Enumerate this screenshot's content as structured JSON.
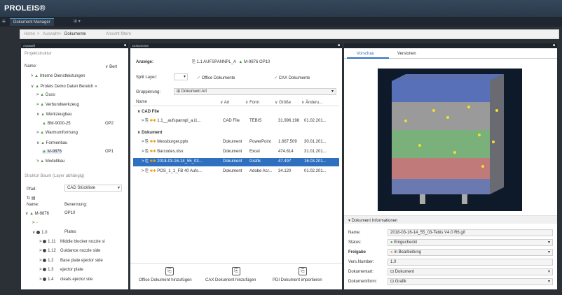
{
  "app": {
    "title": "PROLEIS®"
  },
  "tabs": [
    {
      "label": "Dokument Manager"
    },
    {
      "label": "⊞ ▾"
    }
  ],
  "breadcrumb": {
    "items": [
      "Home",
      "Auswahl",
      "Dokumente"
    ],
    "extra": "Ansicht filtern",
    "sep": ">"
  },
  "left": {
    "header": "Auswahl",
    "section": "Projektstruktur",
    "name_label": "Name:",
    "name_value": "Bert",
    "tree": [
      {
        "label": "Interne Dienstleistungen",
        "indent": 0,
        "arrow": ">"
      },
      {
        "label": "Proleis Demo Daten Bereich »",
        "indent": 0,
        "arrow": "∨"
      },
      {
        "label": "Guss",
        "indent": 1,
        "arrow": ">"
      },
      {
        "label": "Verbundwerkzeug",
        "indent": 1,
        "arrow": ">"
      },
      {
        "label": "Werkzeugbau",
        "indent": 1,
        "arrow": "∨"
      },
      {
        "label": "BM-9000-25",
        "indent": 2,
        "arrow": "",
        "suffix": "OP2"
      },
      {
        "label": "Warmumformung",
        "indent": 1,
        "arrow": ">"
      },
      {
        "label": "Formenbau",
        "indent": 1,
        "arrow": "∨"
      },
      {
        "label": "M-9876",
        "indent": 2,
        "arrow": "",
        "suffix": "OP1",
        "selected": true
      },
      {
        "label": "Modellbau",
        "indent": 1,
        "arrow": ">"
      }
    ],
    "struct_section": "Struktur Baum (Layer abhängig)",
    "pfad_label": "Pfad:",
    "pfad_value": "CAD Stückliste",
    "cols": [
      "Name:",
      "Benennung:"
    ],
    "struct": [
      {
        "name": "M-9876",
        "ben": "OP10",
        "indent": 0,
        "arrow": "∨"
      },
      {
        "name": "",
        "ben": "",
        "indent": 1,
        "arrow": ">"
      },
      {
        "name": "1.0",
        "ben": "Plates",
        "indent": 1,
        "arrow": "∨"
      },
      {
        "name": "1.11",
        "ben": "Middle blocker nozzle si",
        "indent": 2,
        "arrow": ">"
      },
      {
        "name": "1.12",
        "ben": "Guidance nozzle side",
        "indent": 2,
        "arrow": ">"
      },
      {
        "name": "1.2",
        "ben": "Base plate ejector side",
        "indent": 2,
        "arrow": ">"
      },
      {
        "name": "1.3",
        "ben": "ejector plate",
        "indent": 2,
        "arrow": ">"
      },
      {
        "name": "1.4",
        "ben": "cleats ejector site",
        "indent": 2,
        "arrow": ">"
      }
    ]
  },
  "mid": {
    "header": "Dokumente",
    "anzeige_label": "Anzeige:",
    "anzeige_value": "1.1 AUFSPANNPL_A",
    "anzeige_value2": "M-9876 OP10",
    "split_label": "Split Layer:",
    "office_label": "Office Dokumente",
    "cax_label": "CAX Dokumente",
    "grouping_label": "Gruppierung:",
    "grouping_value": "Dokument Art",
    "cols": [
      "Name",
      "Art",
      "Form",
      "Größe",
      "Änderu..."
    ],
    "groups": [
      {
        "title": "CAD File",
        "rows": [
          {
            "name": "1.1__aufspannpl_a.i1...",
            "art": "CAD File",
            "form": "TEBIS",
            "size": "31.996.198",
            "date": "01.02.201...",
            "selected": false
          }
        ]
      },
      {
        "title": "Dokument",
        "rows": [
          {
            "name": "Messburger.pptx",
            "art": "Dokument",
            "form": "PowerPoint",
            "size": "1.667.509",
            "date": "30.01.201...",
            "selected": false
          },
          {
            "name": "Barcodes.xlsx",
            "art": "Dokument",
            "form": "Excel",
            "size": "474.814",
            "date": "31.01.201...",
            "selected": false
          },
          {
            "name": "2018-03-16-14_55_03...",
            "art": "Dokument",
            "form": "Grafik",
            "size": "47.497",
            "date": "16.03.201...",
            "selected": true
          },
          {
            "name": "POS_1_1_FB 40 Aufs...",
            "art": "Dokument",
            "form": "Adobe Acr...",
            "size": "34.120",
            "date": "01.02.201...",
            "selected": false
          }
        ]
      }
    ],
    "buttons": [
      "Office Dokument hinzufügen",
      "CAX Dokument hinzufügen",
      "PDI Dokument importieren"
    ]
  },
  "right": {
    "tabs": [
      "Vorschau",
      "Versionen"
    ],
    "info_header": "Dokument Informationen",
    "fields": [
      {
        "label": "Name:",
        "value": "2018-03-16-14_55_03-Tebis V4.0 R6.gif",
        "dd": false
      },
      {
        "label": "Status:",
        "value": "Eingecheckt",
        "dd": true
      },
      {
        "label": "Freigabe",
        "value": "in Bearbeitung",
        "dd": true
      },
      {
        "label": "Vers.Number:",
        "value": "1.0",
        "dd": false
      },
      {
        "label": "Dokumentart:",
        "value": "Dokument",
        "dd": true
      },
      {
        "label": "Dokumentform:",
        "value": "Grafik",
        "dd": true
      }
    ]
  }
}
